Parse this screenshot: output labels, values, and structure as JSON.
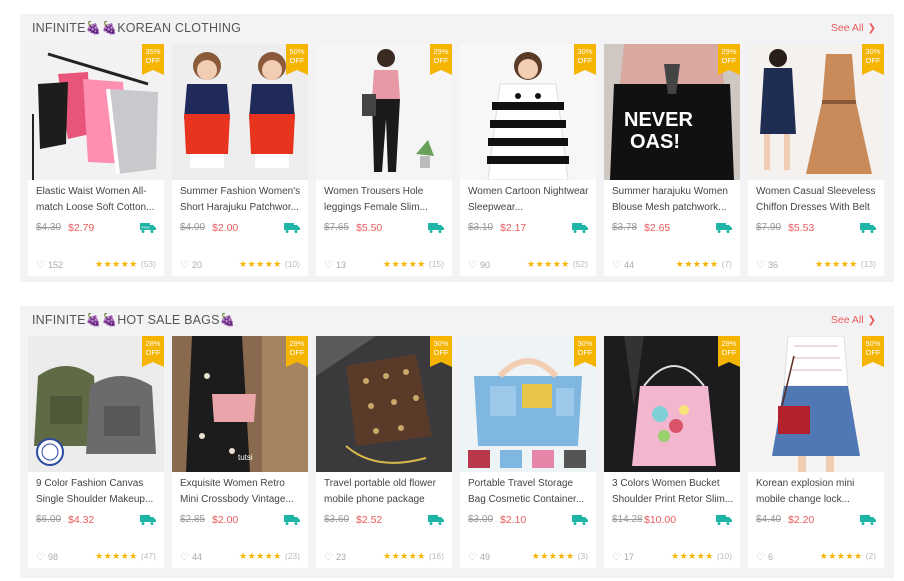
{
  "sections": [
    {
      "title": "INFINITE🍇🍇KOREAN CLOTHING",
      "see_all": "See All",
      "products": [
        {
          "name": "Elastic Waist Women All-match Loose Soft Cotton...",
          "old_price": "$4.30",
          "price": "$2.79",
          "discount": "35% OFF",
          "likes": "152",
          "reviews": "(53)"
        },
        {
          "name": "Summer Fashion Women's Short Harajuku Patchwor...",
          "old_price": "$4.00",
          "price": "$2.00",
          "discount": "50% OFF",
          "likes": "20",
          "reviews": "(10)"
        },
        {
          "name": "Women Trousers Hole leggings Female Slim...",
          "old_price": "$7.65",
          "price": "$5.50",
          "discount": "29% OFF",
          "likes": "13",
          "reviews": "(15)"
        },
        {
          "name": "Women Cartoon Nightwear Sleepwear...",
          "old_price": "$3.10",
          "price": "$2.17",
          "discount": "30% OFF",
          "likes": "90",
          "reviews": "(52)"
        },
        {
          "name": "Summer harajuku Women Blouse Mesh patchwork...",
          "old_price": "$3.78",
          "price": "$2.65",
          "discount": "29% OFF",
          "likes": "44",
          "reviews": "(7)"
        },
        {
          "name": "Women Casual Sleeveless Chiffon Dresses With Belt",
          "old_price": "$7.90",
          "price": "$5.53",
          "discount": "30% OFF",
          "likes": "36",
          "reviews": "(13)"
        }
      ]
    },
    {
      "title": "INFINITE🍇🍇HOT SALE BAGS🍇",
      "see_all": "See All",
      "products": [
        {
          "name": "9 Color Fashion Canvas Single Shoulder Makeup...",
          "old_price": "$6.00",
          "price": "$4.32",
          "discount": "28% OFF",
          "likes": "98",
          "reviews": "(47)"
        },
        {
          "name": "Exquisite Women Retro Mini Crossbody Vintage...",
          "old_price": "$2.85",
          "price": "$2.00",
          "discount": "29% OFF",
          "likes": "44",
          "reviews": "(23)"
        },
        {
          "name": "Travel portable old flower mobile phone package",
          "old_price": "$3.60",
          "price": "$2.52",
          "discount": "30% OFF",
          "likes": "23",
          "reviews": "(16)"
        },
        {
          "name": "Portable Travel Storage Bag Cosmetic Container...",
          "old_price": "$3.00",
          "price": "$2.10",
          "discount": "30% OFF",
          "likes": "49",
          "reviews": "(3)"
        },
        {
          "name": "3 Colors Women Bucket Shoulder Print Retor Slim...",
          "old_price": "$14.28",
          "price": "$10.00",
          "discount": "29% OFF",
          "likes": "17",
          "reviews": "(10)"
        },
        {
          "name": "Korean explosion mini mobile change lock...",
          "old_price": "$4.40",
          "price": "$2.20",
          "discount": "50% OFF",
          "likes": "6",
          "reviews": "(2)"
        }
      ]
    }
  ],
  "rating": "★★★★★",
  "colors": {
    "accent": "#e85a5a",
    "badge": "#f4b400",
    "shipping": "#1fb5a6",
    "section_bg": "#f3f3f5"
  },
  "icons": [
    "heart-icon",
    "free-shipping-truck-icon",
    "chevron-right-icon",
    "grape-emoji-icon"
  ]
}
